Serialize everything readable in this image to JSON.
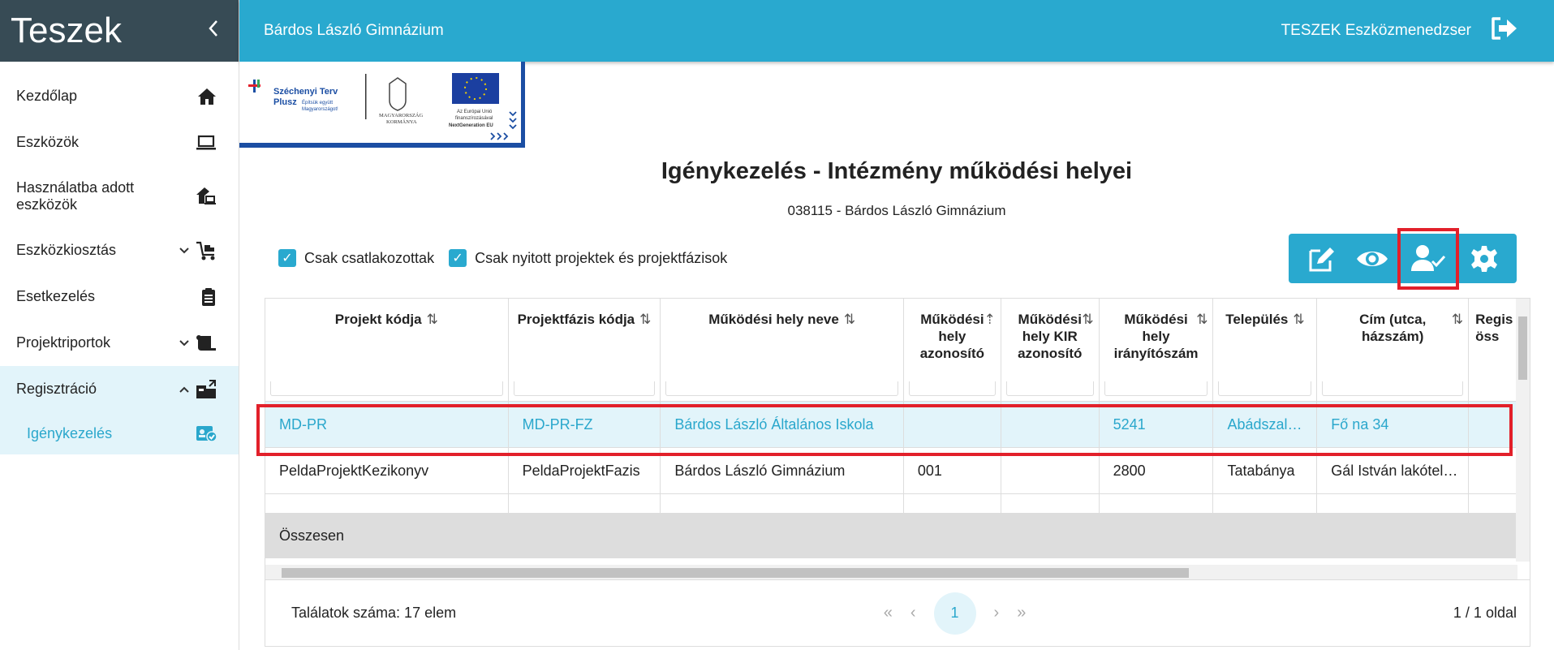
{
  "sidebar": {
    "title": "Teszek",
    "collapse_icon": "chevron-left-icon",
    "items": [
      {
        "label": "Kezdőlap",
        "icon": "home-icon"
      },
      {
        "label": "Eszközök",
        "icon": "laptop-icon"
      },
      {
        "label": "Használatba adott eszközök",
        "icon": "house-device-icon"
      },
      {
        "label": "Eszközkiosztás",
        "icon": "cart-icon"
      },
      {
        "label": "Esetkezelés",
        "icon": "clipboard-icon"
      },
      {
        "label": "Projektriportok",
        "icon": "report-icon"
      },
      {
        "label": "Regisztráció",
        "icon": "registration-icon"
      }
    ],
    "sub_item": {
      "label": "Igénykezelés",
      "icon": "request-icon"
    }
  },
  "topbar": {
    "school": "Bárdos László Gimnázium",
    "app_name": "TESZEK Eszközmenedzser",
    "logout_icon": "logout-icon"
  },
  "logo": {
    "szechenyi": "Széchenyi Terv Plusz",
    "szechenyi_sub": "Építsük együtt Magyarországot!",
    "gov": "MAGYARORSZÁG KORMÁNYA",
    "eu": "Az Európai Unió finanszírozásával NextGeneration EU"
  },
  "page": {
    "title": "Igénykezelés - Intézmény működési helyei",
    "subtitle": "038115 - Bárdos László Gimnázium"
  },
  "filters": [
    {
      "label": "Csak csatlakozottak",
      "checked": true
    },
    {
      "label": "Csak nyitott projektek és projektfázisok",
      "checked": true
    }
  ],
  "actions": [
    "edit-icon",
    "view-icon",
    "user-check-icon",
    "settings-icon"
  ],
  "table": {
    "columns": [
      "Projekt kódja",
      "Projektfázis kódja",
      "Működési hely neve",
      "Működési hely azonosító",
      "Működési hely KIR azonosító",
      "Működési hely irányítószám",
      "Település",
      "Cím (utca, házszám)",
      "Regisztráció összesen"
    ],
    "column_headers_visible": [
      "Projekt kódja",
      "Projektfázis kódja",
      "Működési hely neve",
      "Működési\nhely\nazonosító",
      "Működési\nhely KIR\nazonosító",
      "Működési\nhely\nirányítószám",
      "Település",
      "Cím (utca,\nházszám)",
      "Regis\nöss"
    ],
    "rows": [
      [
        "MD-PR",
        "MD-PR-FZ",
        "Bárdos László Általános Iskola",
        "",
        "",
        "5241",
        "Abádszal…",
        "Fő na 34",
        ""
      ],
      [
        "PeldaProjektKezikonyv",
        "PeldaProjektFazis",
        "Bárdos László Gimnázium",
        "001",
        "",
        "2800",
        "Tatabánya",
        "Gál István lakótel…",
        ""
      ]
    ],
    "total_label": "Összesen"
  },
  "pager": {
    "count_text": "Találatok száma: 17 elem",
    "current_page": "1",
    "page_info": "1 / 1 oldal",
    "first": "«",
    "prev": "‹",
    "next": "›",
    "last": "»"
  },
  "colors": {
    "accent": "#29a9cf",
    "sidebar_head": "#374b55",
    "selected_row": "#e2f4fa",
    "highlight": "#e2202a"
  }
}
